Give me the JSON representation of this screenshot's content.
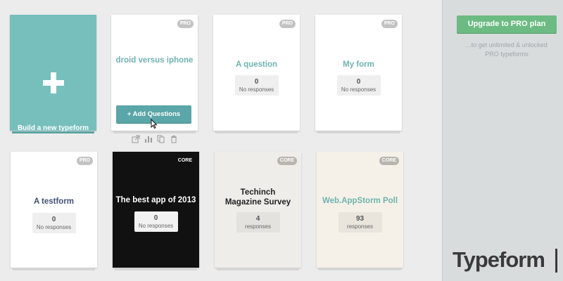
{
  "sidebar": {
    "upgrade_label": "Upgrade to PRO plan",
    "upgrade_sub_line1": "...to get unlimited & unlocked",
    "upgrade_sub_line2": "PRO typeforms",
    "brand": "Typeform"
  },
  "build_card": {
    "label": "Build a new typeform",
    "icon": "plus-icon"
  },
  "forms": [
    {
      "title": "droid versus iphone",
      "badge": "PRO",
      "button_label": "+ Add Questions"
    },
    {
      "title": "A question",
      "badge": "PRO",
      "count": "0",
      "responses_label": "No responses"
    },
    {
      "title": "My form",
      "badge": "PRO",
      "count": "0",
      "responses_label": "No responses"
    },
    {
      "title": "A testform",
      "badge": "PRO",
      "count": "0",
      "responses_label": "No responses"
    },
    {
      "title": "The best app of 2013",
      "badge": "CORE",
      "count": "0",
      "responses_label": "No responses"
    },
    {
      "title": "Techinch Magazine Survey",
      "badge": "CORE",
      "count": "4",
      "responses_label": "responses"
    },
    {
      "title": "Web.AppStorm Poll",
      "badge": "CORE",
      "count": "93",
      "responses_label": "responses"
    }
  ],
  "tool_icons": [
    "share-icon",
    "stats-icon",
    "copy-icon",
    "trash-icon"
  ],
  "colors": {
    "accent_teal": "#76bfbd",
    "button_teal": "#5aa6a8",
    "upgrade_green": "#6cbb83",
    "title_teal": "#6fb3b0",
    "title_navy": "#3f5173",
    "dark_card": "#111111",
    "beige_card": "#efedea",
    "cream_card": "#f5f1e8"
  }
}
